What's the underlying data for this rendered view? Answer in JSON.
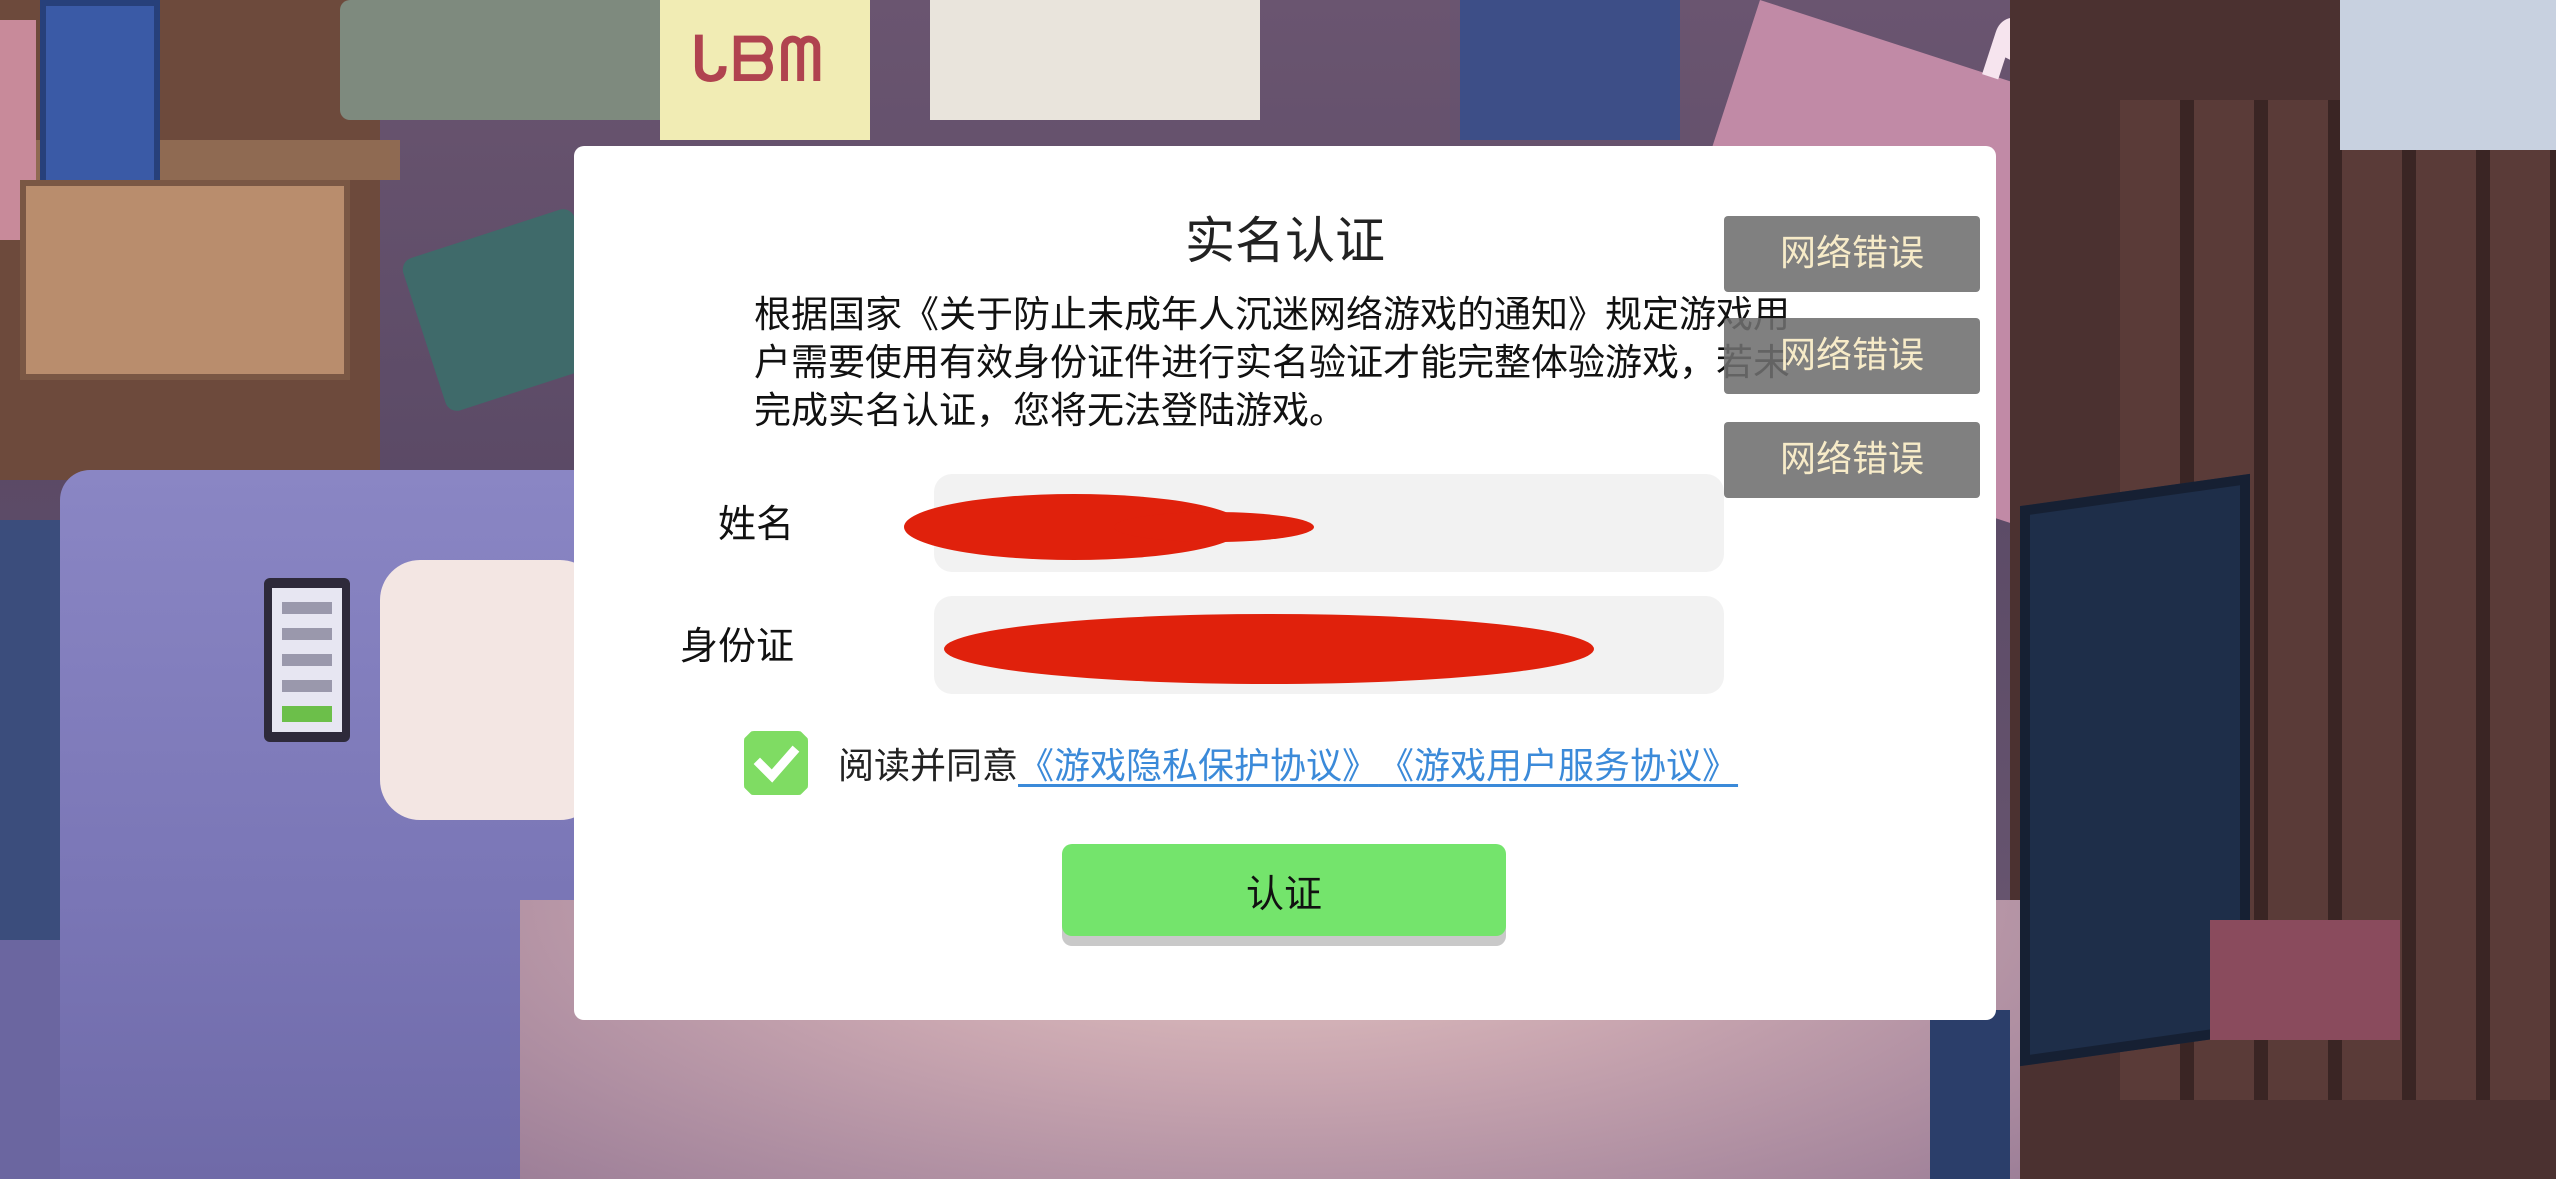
{
  "dialog": {
    "title": "实名认证",
    "description": "根据国家《关于防止未成年人沉迷网络游戏的通知》规定游戏用户需要使用有效身份证件进行实名验证才能完整体验游戏，若未完成实名认证，您将无法登陆游戏。",
    "name_label": "姓名",
    "name_value": "",
    "id_label": "身份证",
    "id_value": "",
    "agree_prefix": "阅读并同意",
    "privacy_link": "《游戏隐私保护协议》",
    "service_link": "《游戏用户服务协议》",
    "agree_checked": true,
    "submit_label": "认证"
  },
  "toasts": [
    "网络错误",
    "网络错误",
    "网络错误"
  ],
  "background": {
    "sticky_note_text": "ᒐᗷᗰ",
    "pink_sheet_text": "ᑭᗩ"
  },
  "colors": {
    "accent_green": "#74e46c",
    "link_blue": "#3b8ad9",
    "toast_text": "#f7ebc8",
    "redaction_red": "#e0210c"
  }
}
